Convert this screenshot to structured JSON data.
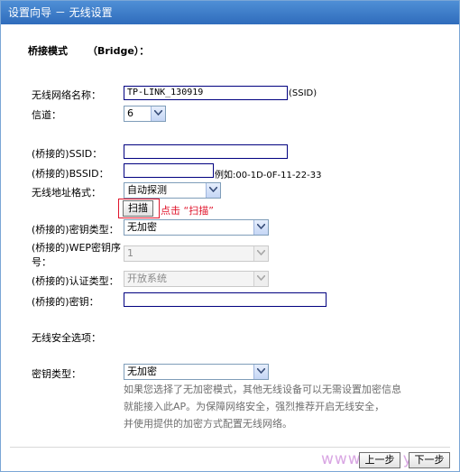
{
  "title": "设置向导 － 无线设置",
  "section_bridge": {
    "label": "桥接模式",
    "value": "（Bridge）："
  },
  "ssid": {
    "label": "无线网络名称：",
    "value": "TP-LINK_130919",
    "suffix": "(SSID)"
  },
  "channel": {
    "label": "信道：",
    "value": "6"
  },
  "bridged_ssid": {
    "label": "(桥接的)SSID：",
    "value": ""
  },
  "bridged_bssid": {
    "label": "(桥接的)BSSID：",
    "value": "",
    "example": "例如:00-1D-0F-11-22-33"
  },
  "addr_format": {
    "label": "无线地址格式：",
    "value": "自动探测"
  },
  "scan": {
    "button": "扫描",
    "hint": "点击 “扫描”"
  },
  "key_type_bridged": {
    "label": "(桥接的)密钥类型：",
    "value": "无加密"
  },
  "wep_index": {
    "label_line1": "(桥接的)WEP密钥序",
    "label_line2": "号：",
    "value": "1"
  },
  "auth_type": {
    "label": "(桥接的)认证类型：",
    "value": "开放系统"
  },
  "bridged_key": {
    "label": "(桥接的)密钥：",
    "value": ""
  },
  "security": {
    "label": "无线安全选项："
  },
  "key_type": {
    "label": "密钥类型：",
    "value": "无加密"
  },
  "note_lines": [
    "如果您选择了无加密模式，其他无线设备可以无需设置加密信息",
    "就能接入此AP。为保障网络安全，强烈推荐开启无线安全，",
    "并使用提供的加密方式配置无线网络。"
  ],
  "nav": {
    "prev": "上一步",
    "next": "下一步"
  },
  "watermark": "www.192ly.com",
  "colors": {
    "titlebar": "#2f6cbc",
    "accent_red": "#e0142b",
    "border": "#7aa6d6"
  }
}
